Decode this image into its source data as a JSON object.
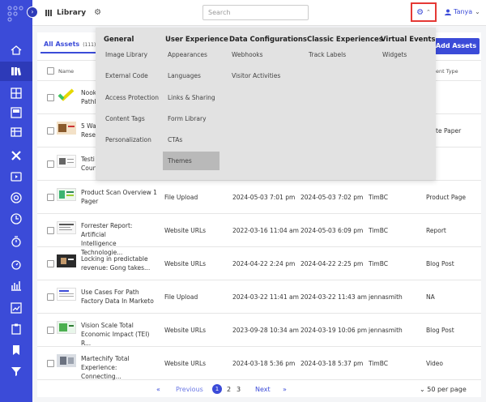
{
  "header": {
    "title": "Library",
    "search_placeholder": "Search",
    "user_name": "Tanya"
  },
  "tabs": {
    "all_assets_label": "All Assets",
    "all_assets_count": "(111)"
  },
  "add_button_label": "Add Assets",
  "table": {
    "col_name": "Name",
    "col_type_partial": "ent Type",
    "rows": [
      {
        "title": "Nook\nPathl",
        "type": ""
      },
      {
        "title": "5 Wa\nResea",
        "type": "te Paper"
      },
      {
        "title": "Testi\nCoun",
        "type": ""
      },
      {
        "title": "Product Scan Overview 1\nPager",
        "source": "File Upload",
        "created": "2024-05-03 7:01 pm",
        "updated": "2024-05-03 7:02 pm",
        "author": "TimBC",
        "type": "Product Page"
      },
      {
        "title": "Forrester Report: Artificial\nIntelligence Technologie...",
        "source": "Website URLs",
        "created": "2022-03-16 11:04 am",
        "updated": "2024-05-03 6:09 pm",
        "author": "TimBC",
        "type": "Report"
      },
      {
        "title": "Locking in predictable\nrevenue: Gong takes...",
        "source": "Website URLs",
        "created": "2024-04-22 2:24 pm",
        "updated": "2024-04-22 2:25 pm",
        "author": "TimBC",
        "type": "Blog Post"
      },
      {
        "title": "Use Cases For Path\nFactory Data In Marketo",
        "source": "File Upload",
        "created": "2024-03-22 11:41 am",
        "updated": "2024-03-22 11:43 am",
        "author": "jennasmith",
        "type": "NA"
      },
      {
        "title": "Vision Scale Total\nEconomic Impact (TEI) R...",
        "source": "Website URLs",
        "created": "2023-09-28 10:34 am",
        "updated": "2024-03-19 10:06 pm",
        "author": "jennasmith",
        "type": "Blog Post"
      },
      {
        "title": "Martechify Total\nExperience: Connecting...",
        "source": "Website URLs",
        "created": "2024-03-18 5:36 pm",
        "updated": "2024-03-18 5:37 pm",
        "author": "TimBC",
        "type": "Video"
      }
    ]
  },
  "pagination": {
    "first": "«",
    "previous": "Previous",
    "page1": "1",
    "page2": "2",
    "page3": "3",
    "next": "Next",
    "last": "»",
    "per_page": "50 per page"
  },
  "settings_menu": {
    "general": {
      "heading": "General",
      "items": [
        "Image Library",
        "External Code",
        "Access Protection",
        "Content Tags",
        "Personalization"
      ]
    },
    "user_experience": {
      "heading": "User Experience",
      "items": [
        "Appearances",
        "Languages",
        "Links & Sharing",
        "Form Library",
        "CTAs",
        "Themes"
      ]
    },
    "data_configurations": {
      "heading": "Data Configurations",
      "items": [
        "Webhooks",
        "Visitor Activities"
      ]
    },
    "classic_experiences": {
      "heading": "Classic Experiences",
      "items": [
        "Track Labels"
      ]
    },
    "virtual_events": {
      "heading": "Virtual Events",
      "items": [
        "Widgets"
      ]
    }
  },
  "colors": {
    "brand": "#3b4bd8",
    "highlight_box": "#e53935",
    "menu_bg": "#e2e2e2",
    "menu_selected": "#b9b9b9"
  },
  "icons": [
    "logo-icon",
    "chevron-right-icon",
    "home-icon",
    "library-icon",
    "gear-icon",
    "chevron-up-icon",
    "user-icon",
    "chevron-down-icon"
  ]
}
